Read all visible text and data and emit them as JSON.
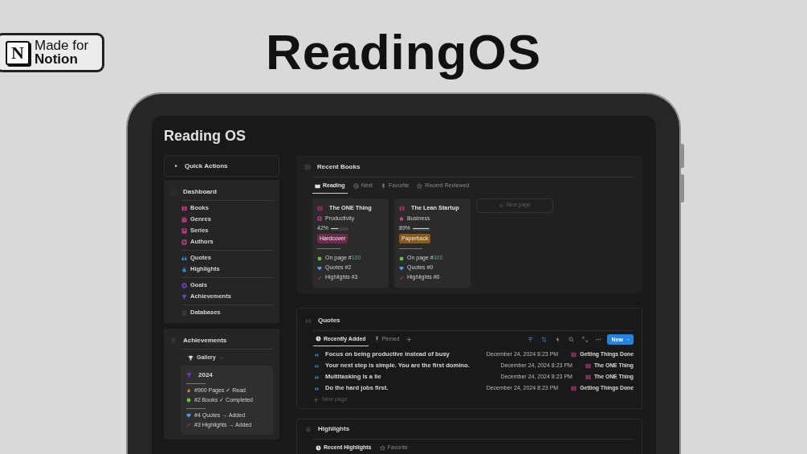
{
  "badge": {
    "logo_letter": "N",
    "line_1": "Made for",
    "line_2": "Notion"
  },
  "headline": "ReadingOS",
  "page_title": "Reading OS",
  "quick_actions": {
    "label": "Quick Actions",
    "expanded": false
  },
  "dashboard": {
    "title": "Dashboard",
    "groups": [
      [
        {
          "label": "Books",
          "color": "#b1357a"
        },
        {
          "label": "Genres",
          "color": "#b1357a"
        },
        {
          "label": "Series",
          "color": "#b1357a"
        },
        {
          "label": "Authors",
          "color": "#b1357a"
        }
      ],
      [
        {
          "label": "Quotes",
          "color": "#2f86c0"
        },
        {
          "label": "Highlights",
          "color": "#2f86c0"
        }
      ],
      [
        {
          "label": "Goals",
          "color": "#7145c2"
        },
        {
          "label": "Achievements",
          "color": "#7145c2"
        }
      ],
      [
        {
          "label": "Databases",
          "color": "#3a3a3a"
        }
      ]
    ]
  },
  "achievements": {
    "title": "Achievements",
    "view": "Gallery",
    "card": {
      "title": "2024",
      "groups": [
        [
          "#900 Pages ✓ Read",
          "#2 Books ✓ Completed"
        ],
        [
          "#4 Quotes → Added",
          "#3 Highlights → Added"
        ]
      ]
    }
  },
  "recent_books": {
    "title": "Recent Books",
    "tabs": [
      {
        "label": "Reading",
        "selected": true
      },
      {
        "label": "Next",
        "selected": false
      },
      {
        "label": "Favorite",
        "selected": false
      },
      {
        "label": "Recent Reviewed",
        "selected": false
      }
    ],
    "cards": [
      {
        "title": "The ONE Thing",
        "genre": "Productivity",
        "progress": "42%",
        "level": 0.42,
        "format": "Hardcover",
        "color": "#6e2a4b",
        "page_prefix": "On page #",
        "page_number": "100",
        "quotes": "Quotes #2",
        "highlights": "Highlights #3"
      },
      {
        "title": "The Lean Startup",
        "genre": "Business",
        "progress": "89%",
        "level": 0.89,
        "format": "Paperback",
        "color": "#8a5a1c",
        "page_prefix": "On page #",
        "page_number": "300",
        "quotes": "Quotes #0",
        "highlights": "Highlights #0"
      }
    ],
    "new_page": "New page"
  },
  "quotes": {
    "title": "Quotes",
    "tabs": [
      {
        "label": "Recently Added",
        "selected": true
      },
      {
        "label": "Pinned",
        "selected": false
      }
    ],
    "new_button": "New",
    "rows": [
      {
        "text": "Focus on being productive instead of busy",
        "date": "December 24, 2024 8:23 PM",
        "book": "Getting Things Done"
      },
      {
        "text": "Your next step is simple. You are the first domino.",
        "date": "December 24, 2024 8:23 PM",
        "book": "The ONE Thing"
      },
      {
        "text": "Multitasking is a lie",
        "date": "December 24, 2024 8:23 PM",
        "book": "The ONE Thing"
      },
      {
        "text": "Do the hard jobs first.",
        "date": "December 24, 2024 8:23 PM",
        "book": "Getting Things Done"
      }
    ],
    "new_page": "New page"
  },
  "highlights": {
    "title": "Highlights",
    "tabs": [
      {
        "label": "Recent Highlights",
        "selected": true
      },
      {
        "label": "Favorite",
        "selected": false
      }
    ]
  }
}
